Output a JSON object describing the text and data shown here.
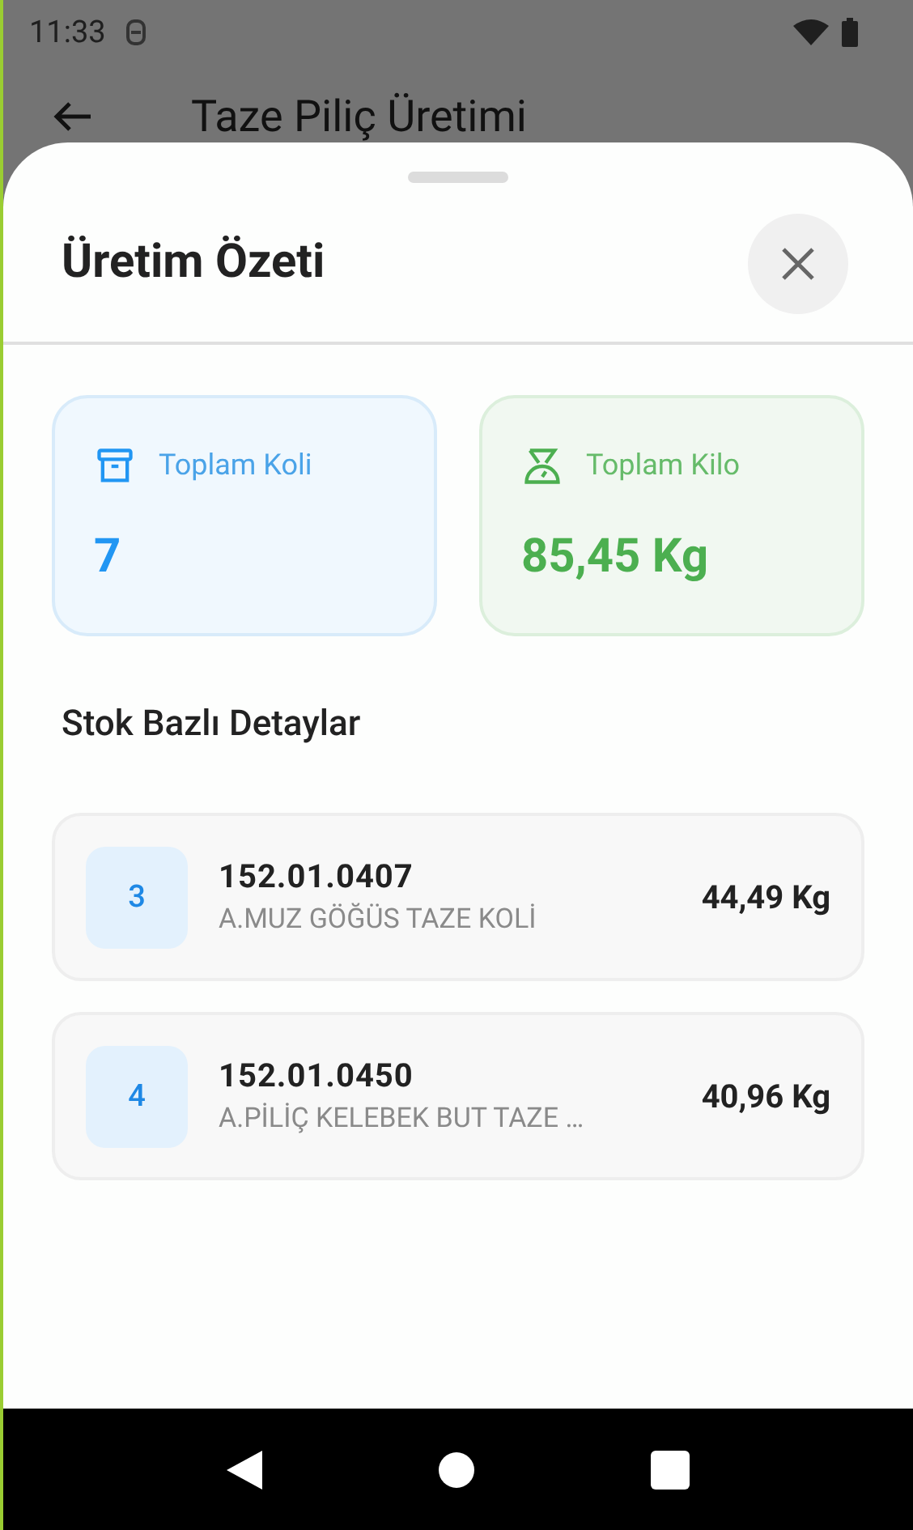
{
  "status_bar": {
    "time": "11:33"
  },
  "app_bar": {
    "title": "Taze Piliç Üretimi"
  },
  "sheet": {
    "title": "Üretim Özeti",
    "summary_cards": [
      {
        "kind": "boxes",
        "label": "Toplam Koli",
        "value": "7"
      },
      {
        "kind": "weight",
        "label": "Toplam Kilo",
        "value": "85,45 Kg"
      }
    ],
    "section_title": "Stok Bazlı Detaylar",
    "items": [
      {
        "count": "3",
        "code": "152.01.0407",
        "name": "A.MUZ GÖĞÜS TAZE KOLİ",
        "weight": "44,49 Kg"
      },
      {
        "count": "4",
        "code": "152.01.0450",
        "name": "A.PİLİÇ KELEBEK BUT TAZE …",
        "weight": "40,96 Kg"
      }
    ]
  }
}
